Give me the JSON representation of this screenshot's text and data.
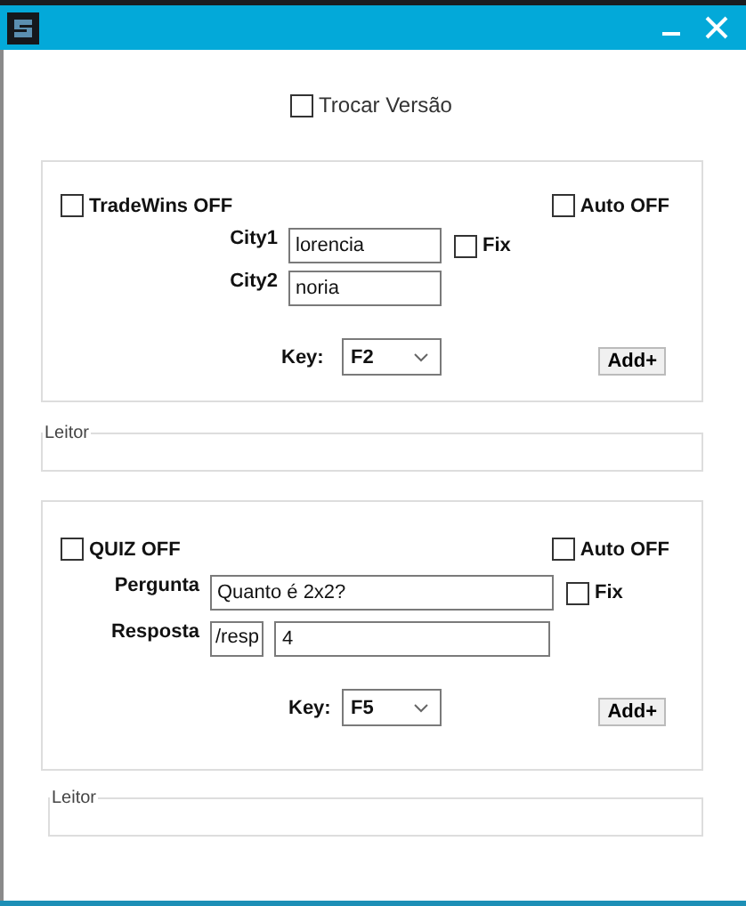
{
  "version_toggle": {
    "label": "Trocar Versão",
    "checked": false
  },
  "tradewins": {
    "toggle": {
      "label": "TradeWins OFF",
      "checked": false
    },
    "auto": {
      "label": "Auto OFF",
      "checked": false
    },
    "fields": [
      {
        "label": "City1",
        "value": "lorencia"
      },
      {
        "label": "City2",
        "value": "noria"
      }
    ],
    "fix": {
      "label": "Fix",
      "checked": false
    },
    "key": {
      "label": "Key:",
      "value": "F2"
    },
    "add_button": "Add+"
  },
  "reader_1": {
    "title": "Leitor"
  },
  "quiz": {
    "toggle": {
      "label": "QUIZ OFF",
      "checked": false
    },
    "auto": {
      "label": "Auto OFF",
      "checked": false
    },
    "question": {
      "label": "Pergunta",
      "value": "Quanto é 2x2?"
    },
    "fix": {
      "label": "Fix",
      "checked": false
    },
    "answer": {
      "label": "Resposta",
      "prefix": "/resp",
      "value": "4"
    },
    "key": {
      "label": "Key:",
      "value": "F5"
    },
    "add_button": "Add+"
  },
  "reader_2": {
    "title": "Leitor"
  }
}
